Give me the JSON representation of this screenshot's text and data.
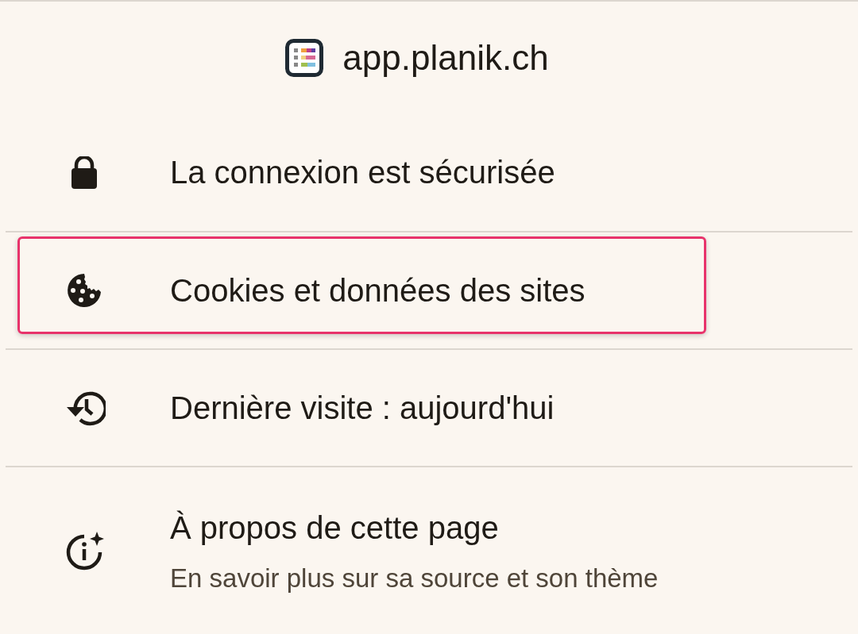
{
  "header": {
    "site": "app.planik.ch"
  },
  "items": [
    {
      "title": "La connexion est sécurisée",
      "highlighted": false
    },
    {
      "title": "Cookies et données des sites",
      "highlighted": true
    },
    {
      "title": "Dernière visite : aujourd'hui",
      "highlighted": false
    },
    {
      "title": "À propos de cette page",
      "subtitle": "En savoir plus sur sa source et son thème",
      "highlighted": false
    }
  ]
}
